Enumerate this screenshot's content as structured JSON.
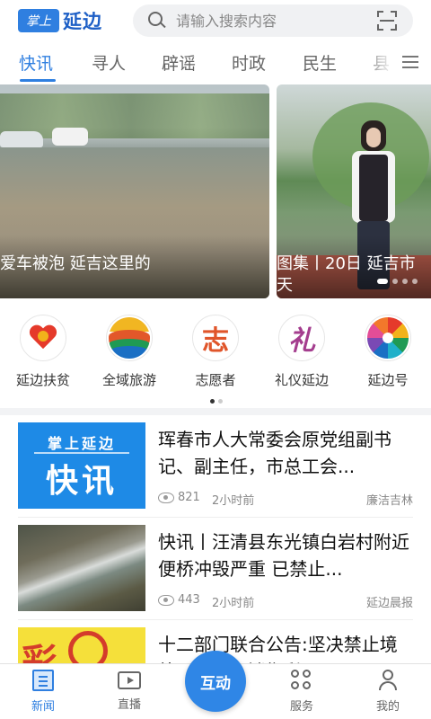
{
  "header": {
    "logo_badge": "掌上",
    "logo_text": "延边",
    "search_placeholder": "请输入搜索内容"
  },
  "tabs": [
    {
      "label": "快讯",
      "active": true
    },
    {
      "label": "寻人"
    },
    {
      "label": "辟谣"
    },
    {
      "label": "时政"
    },
    {
      "label": "民生"
    },
    {
      "label": "县"
    }
  ],
  "banner": {
    "slides": [
      {
        "caption": "爱车被泡 延吉这里的"
      },
      {
        "caption": "图集丨20日 延吉市 天"
      }
    ],
    "active_index": 0
  },
  "quick_access": {
    "items": [
      {
        "label": "延边扶贫",
        "icon": "heart-icon"
      },
      {
        "label": "全域旅游",
        "icon": "tourism-icon"
      },
      {
        "label": "志愿者",
        "icon": "volunteer-icon",
        "glyph": "志"
      },
      {
        "label": "礼仪延边",
        "icon": "etiquette-icon",
        "glyph": "礼"
      },
      {
        "label": "延边号",
        "icon": "pinwheel-icon"
      }
    ],
    "page": 1,
    "pages": 2
  },
  "news": [
    {
      "title": "珲春市人大常委会原党组副书记、副主任，市总工会...",
      "views": "821",
      "time": "2小时前",
      "source": "廉洁吉林",
      "thumb_line1": "掌上延边",
      "thumb_line2": "快讯"
    },
    {
      "title": "快讯丨汪清县东光镇白岩村附近便桥冲毁严重  已禁止...",
      "views": "443",
      "time": "2小时前",
      "source": "延边晨报"
    },
    {
      "title": "十二部门联合公告:坚决禁止境外...互联网销售彩票"
    }
  ],
  "bottom_nav": {
    "items": [
      {
        "label": "新闻",
        "active": true
      },
      {
        "label": "直播"
      },
      {
        "label": "服务"
      },
      {
        "label": "我的"
      }
    ],
    "center_label": "互动"
  },
  "colors": {
    "accent": "#2f7fe0",
    "fab": "#2f86e6"
  }
}
